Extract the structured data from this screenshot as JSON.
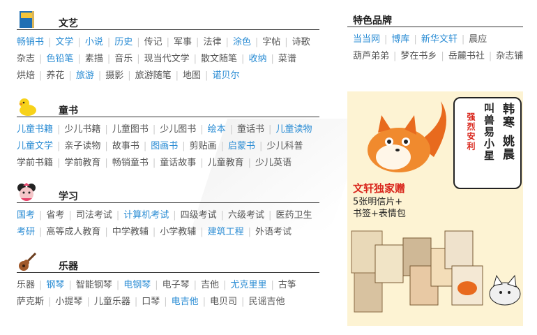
{
  "sections": [
    {
      "title": "文艺",
      "icon": "book-icon",
      "rows": [
        [
          {
            "t": "畅销书",
            "h": true
          },
          {
            "t": "文学",
            "h": true
          },
          {
            "t": "小说",
            "h": true
          },
          {
            "t": "历史",
            "h": true
          },
          {
            "t": "传记",
            "h": false
          },
          {
            "t": "军事",
            "h": false
          },
          {
            "t": "法律",
            "h": false
          },
          {
            "t": "涂色",
            "h": true
          },
          {
            "t": "字帖",
            "h": false
          },
          {
            "t": "诗歌",
            "h": false
          }
        ],
        [
          {
            "t": "杂志",
            "h": false
          },
          {
            "t": "色铅笔",
            "h": true
          },
          {
            "t": "素描",
            "h": false
          },
          {
            "t": "音乐",
            "h": false
          },
          {
            "t": "现当代文学",
            "h": false
          },
          {
            "t": "散文随笔",
            "h": false
          },
          {
            "t": "收纳",
            "h": true
          },
          {
            "t": "菜谱",
            "h": false
          }
        ],
        [
          {
            "t": "烘焙",
            "h": false
          },
          {
            "t": "养花",
            "h": false
          },
          {
            "t": "旅游",
            "h": true
          },
          {
            "t": "摄影",
            "h": false
          },
          {
            "t": "旅游随笔",
            "h": false
          },
          {
            "t": "地图",
            "h": false
          },
          {
            "t": "诺贝尔",
            "h": true
          }
        ]
      ]
    },
    {
      "title": "童书",
      "icon": "duck-icon",
      "rows": [
        [
          {
            "t": "儿童书籍",
            "h": true
          },
          {
            "t": "少儿书籍",
            "h": false
          },
          {
            "t": "儿童图书",
            "h": false
          },
          {
            "t": "少儿图书",
            "h": false
          },
          {
            "t": "绘本",
            "h": true
          },
          {
            "t": "童话书",
            "h": false
          },
          {
            "t": "儿童读物",
            "h": true
          }
        ],
        [
          {
            "t": "儿童文学",
            "h": true
          },
          {
            "t": "亲子读物",
            "h": false
          },
          {
            "t": "故事书",
            "h": false
          },
          {
            "t": "图画书",
            "h": true
          },
          {
            "t": "剪贴画",
            "h": false
          },
          {
            "t": "启蒙书",
            "h": true
          },
          {
            "t": "少儿科普",
            "h": false
          }
        ],
        [
          {
            "t": "学前书籍",
            "h": false
          },
          {
            "t": "学前教育",
            "h": false
          },
          {
            "t": "畅销童书",
            "h": false
          },
          {
            "t": "童话故事",
            "h": false
          },
          {
            "t": "儿童教育",
            "h": false
          },
          {
            "t": "少儿英语",
            "h": false
          }
        ]
      ]
    },
    {
      "title": "学习",
      "icon": "mouse-icon",
      "rows": [
        [
          {
            "t": "国考",
            "h": true
          },
          {
            "t": "省考",
            "h": false
          },
          {
            "t": "司法考试",
            "h": false
          },
          {
            "t": "计算机考试",
            "h": true
          },
          {
            "t": "四级考试",
            "h": false
          },
          {
            "t": "六级考试",
            "h": false
          },
          {
            "t": "医药卫生",
            "h": false
          }
        ],
        [
          {
            "t": "考研",
            "h": true
          },
          {
            "t": "高等成人教育",
            "h": false
          },
          {
            "t": "中学教辅",
            "h": false
          },
          {
            "t": "小学教辅",
            "h": false
          },
          {
            "t": "建筑工程",
            "h": true
          },
          {
            "t": "外语考试",
            "h": false
          }
        ]
      ]
    },
    {
      "title": "乐器",
      "icon": "guitar-icon",
      "rows": [
        [
          {
            "t": "乐器",
            "h": false
          },
          {
            "t": "钢琴",
            "h": true
          },
          {
            "t": "智能钢琴",
            "h": false
          },
          {
            "t": "电钢琴",
            "h": true
          },
          {
            "t": "电子琴",
            "h": false
          },
          {
            "t": "吉他",
            "h": false
          },
          {
            "t": "尤克里里",
            "h": true
          },
          {
            "t": "古筝",
            "h": false
          }
        ],
        [
          {
            "t": "萨克斯",
            "h": false
          },
          {
            "t": "小提琴",
            "h": false
          },
          {
            "t": "儿童乐器",
            "h": false
          },
          {
            "t": "口琴",
            "h": false
          },
          {
            "t": "电吉他",
            "h": true
          },
          {
            "t": "电贝司",
            "h": false
          },
          {
            "t": "民谣吉他",
            "h": false
          }
        ]
      ]
    }
  ],
  "brands": {
    "title": "特色品牌",
    "rows": [
      [
        {
          "t": "当当网",
          "h": true
        },
        {
          "t": "博库",
          "h": true
        },
        {
          "t": "新华文轩",
          "h": true
        },
        {
          "t": "晨应",
          "h": false
        }
      ],
      [
        {
          "t": "葫芦弟弟",
          "h": false
        },
        {
          "t": "梦在书乡",
          "h": false
        },
        {
          "t": "岳麓书社",
          "h": false
        },
        {
          "t": "杂志铺",
          "h": false
        }
      ]
    ]
  },
  "banner": {
    "authors": "韩寒 姚晨",
    "book_title": "叫兽易小星",
    "recommend": "强烈安利",
    "promo_title": "文轩独家赠",
    "promo_line1": "5张明信片+",
    "promo_line2": "书签+表情包"
  },
  "colors": {
    "link": "#555555",
    "highlight": "#2a8cd4",
    "accent_red": "#d9261c",
    "banner_bg": "#fdf3d3"
  }
}
